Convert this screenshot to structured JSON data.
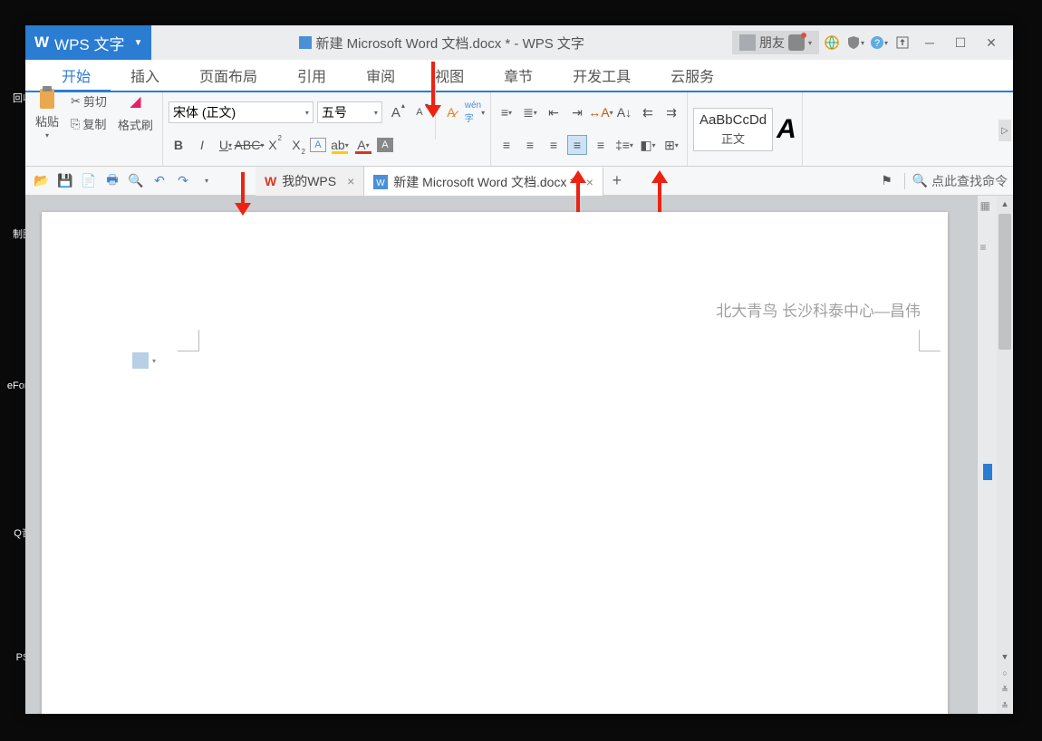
{
  "desktop": {
    "icons": [
      "回收",
      "制图",
      "eForce",
      "Q音",
      "PS"
    ]
  },
  "title": {
    "app_badge": "WPS 文字",
    "document": "新建 Microsoft Word 文档.docx * - WPS 文字",
    "user": "朋友"
  },
  "ribbon_tabs": [
    "开始",
    "插入",
    "页面布局",
    "引用",
    "审阅",
    "视图",
    "章节",
    "开发工具",
    "云服务"
  ],
  "clipboard": {
    "paste": "粘贴",
    "cut": "剪切",
    "copy": "复制",
    "format_painter": "格式刷"
  },
  "font": {
    "name": "宋体 (正文)",
    "size": "五号"
  },
  "style": {
    "sample": "AaBbCcDd",
    "name": "正文"
  },
  "doc_tabs": {
    "tab1": "我的WPS",
    "tab2": "新建 Microsoft Word 文档.docx *"
  },
  "search": {
    "placeholder": "点此查找命令"
  },
  "page": {
    "header_text": "北大青鸟  长沙科泰中心—昌伟"
  }
}
